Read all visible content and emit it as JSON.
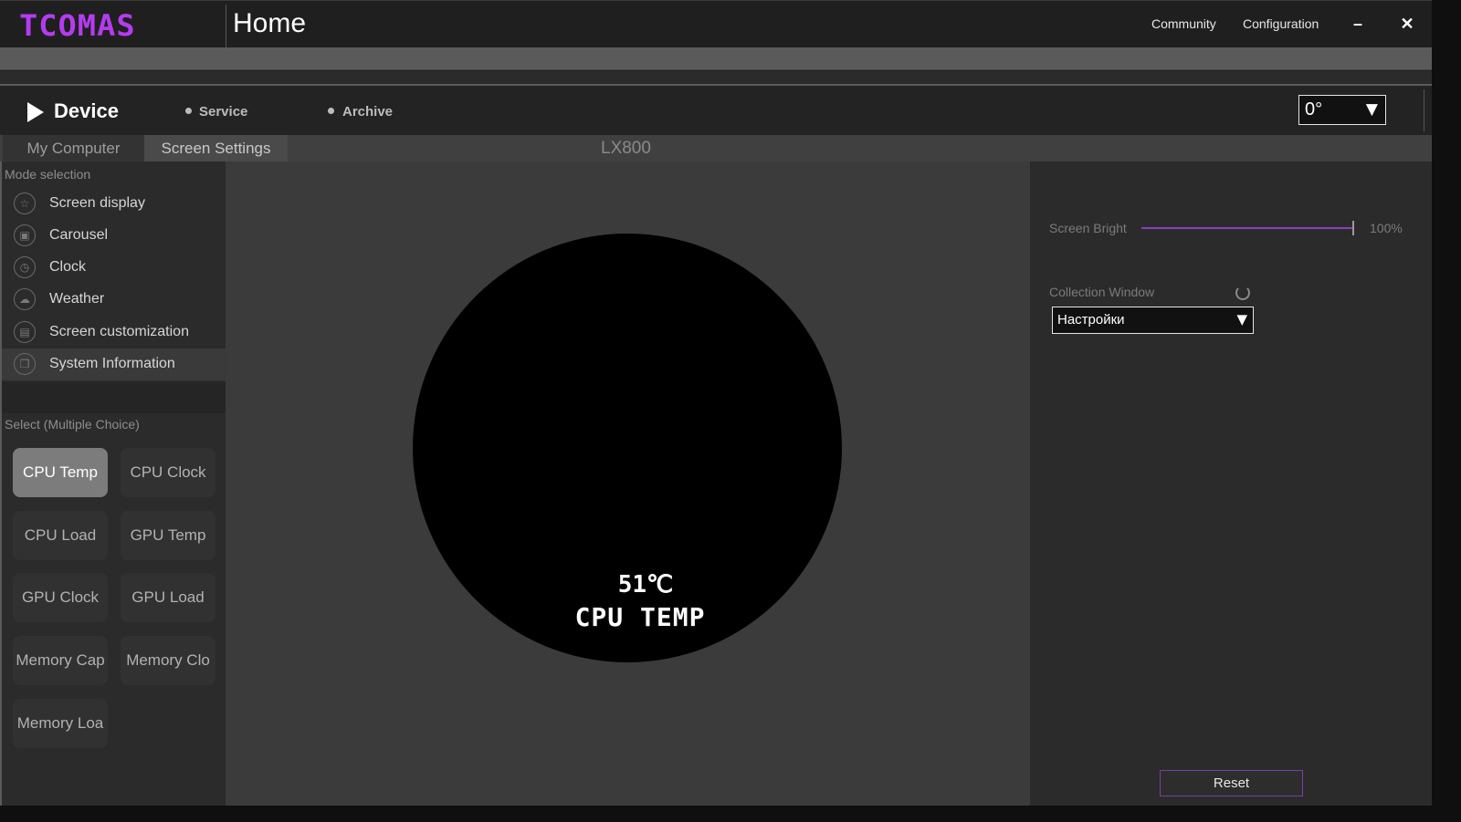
{
  "app": {
    "logo": "TCOMAS",
    "page_title": "Home"
  },
  "top_links": {
    "community": "Community",
    "configuration": "Configuration"
  },
  "window_controls": {
    "minimize": "–",
    "close": "✕"
  },
  "nav": {
    "device": "Device",
    "service": "Service",
    "archive": "Archive",
    "rotation_value": "0°",
    "dropdown_arrow": "▼"
  },
  "tabs": {
    "my_computer": "My Computer",
    "screen_settings": "Screen Settings",
    "device_name": "LX800"
  },
  "left_panel": {
    "mode_selection_label": "Mode selection",
    "modes": [
      {
        "label": "Screen display",
        "icon": "screen-display-icon"
      },
      {
        "label": "Carousel",
        "icon": "carousel-icon"
      },
      {
        "label": "Clock",
        "icon": "clock-icon"
      },
      {
        "label": "Weather",
        "icon": "weather-icon"
      },
      {
        "label": "Screen customization",
        "icon": "screen-customization-icon"
      },
      {
        "label": "System Information",
        "icon": "system-information-icon"
      }
    ],
    "active_mode": "System Information",
    "select_label": "Select (Multiple Choice)",
    "chips": [
      "CPU Temp",
      "CPU Clock",
      "CPU Load",
      "GPU Temp",
      "GPU Clock",
      "GPU Load",
      "Memory Cap",
      "Memory Clo",
      "Memory Loa"
    ],
    "selected_chip": "CPU Temp"
  },
  "preview": {
    "value": "51℃",
    "label": "CPU TEMP"
  },
  "right_panel": {
    "screen_bright_label": "Screen Bright",
    "screen_bright_value": "100%",
    "brightness_fraction": 1.0,
    "collection_window_label": "Collection Window",
    "collection_window_value": "Настройки",
    "reset_label": "Reset"
  },
  "colors": {
    "accent": "#b53bf0",
    "slider": "#8a3fb8",
    "reset_border": "#7a3fa5"
  }
}
